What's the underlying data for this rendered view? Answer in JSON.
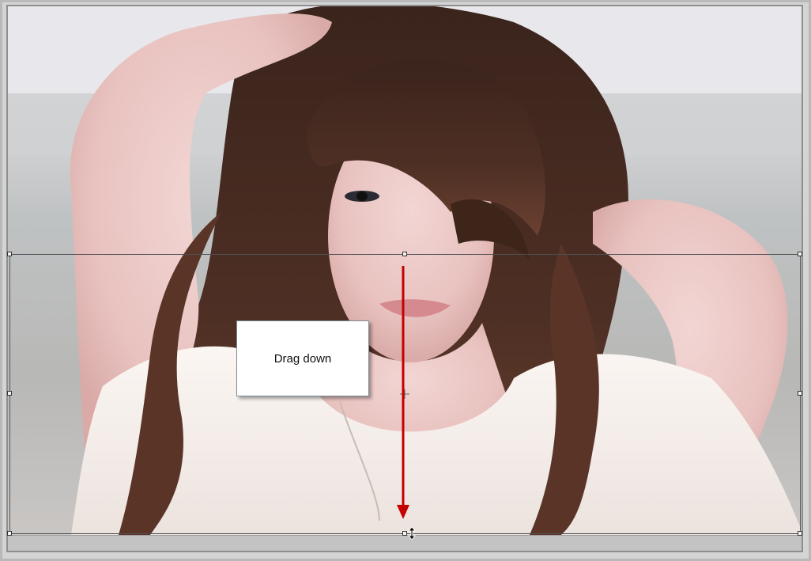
{
  "callout": {
    "text": "Drag down"
  },
  "annotation": {
    "arrow_color": "#c40000",
    "arrow_direction": "down"
  },
  "selection": {
    "line_color": "#4d4f55",
    "handle_fill": "#f2f2f2"
  }
}
